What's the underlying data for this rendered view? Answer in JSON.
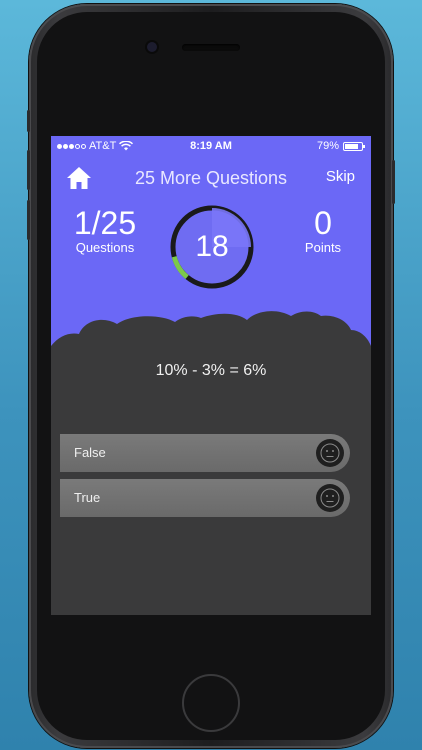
{
  "status_bar": {
    "carrier": "AT&T",
    "time": "8:19 AM",
    "battery": "79%",
    "battery_level": 0.79,
    "signal_bars_filled": 3,
    "signal_bars_total": 5
  },
  "header": {
    "title": "25 More Questions",
    "skip_label": "Skip",
    "home_icon": "home-icon"
  },
  "progress": {
    "count": "1/25",
    "count_label": "Questions"
  },
  "timer": {
    "seconds": "18",
    "elapsed_fraction": 0.1
  },
  "score": {
    "points": "0",
    "points_label": "Points"
  },
  "question": {
    "text": "10% - 3% = 6%"
  },
  "answers": [
    {
      "label": "False",
      "icon": "neutral-face-icon"
    },
    {
      "label": "True",
      "icon": "neutral-face-icon"
    }
  ],
  "colors": {
    "hero": "#6b68f6",
    "body": "#3a3a3b",
    "timer_ring": "#1a1a1a",
    "timer_progress": "#7cc84a"
  }
}
